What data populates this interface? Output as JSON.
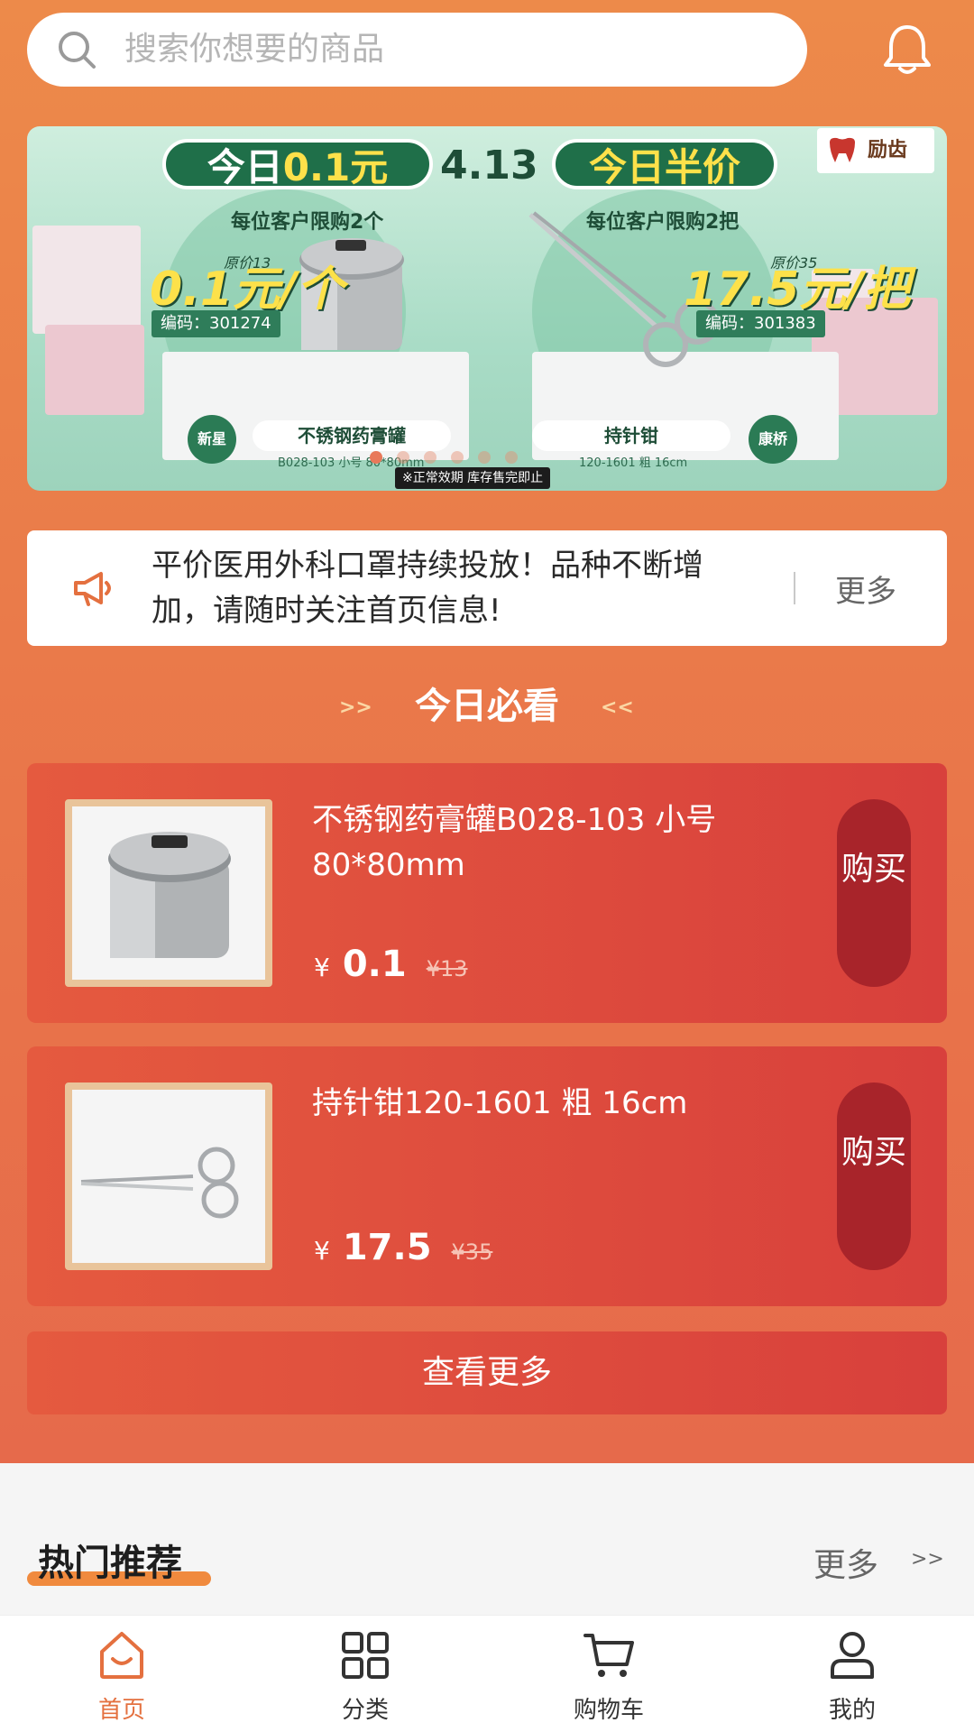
{
  "search": {
    "placeholder": "搜索你想要的商品"
  },
  "banner": {
    "left": {
      "title_prefix": "今日",
      "title_highlight": "0.1元",
      "limit": "每位客户限购2个",
      "price": "0.1元/个",
      "original": "原价13",
      "code": "编码：301274",
      "name": "不锈钢药膏罐",
      "spec": "B028-103 小号 80*80mm",
      "tag": "新星"
    },
    "date": "4.13",
    "right": {
      "title": "今日半价",
      "limit": "每位客户限购2把",
      "price": "17.5元/把",
      "original": "原价35",
      "code": "编码：301383",
      "name": "持针钳",
      "spec": "120-1601 粗 16cm",
      "tag": "康桥"
    },
    "notice": "※正常效期 库存售完即止",
    "logo": "励齿",
    "dots": 6,
    "active_dot": 0
  },
  "announcement": {
    "text": "平价医用外科口罩持续投放！品种不断增加，请随时关注首页信息!",
    "more": "更多"
  },
  "today_section": {
    "title": "今日必看",
    "left_mark": ">>",
    "right_mark": "<<"
  },
  "products": [
    {
      "name": "不锈钢药膏罐B028-103 小号 80*80mm",
      "currency": "¥",
      "price": "0.1",
      "original_price": "¥13",
      "buy_label": "购买"
    },
    {
      "name": "持针钳120-1601 粗 16cm",
      "currency": "¥",
      "price": "17.5",
      "original_price": "¥35",
      "buy_label": "购买"
    }
  ],
  "view_more": "查看更多",
  "hot": {
    "title": "热门推荐",
    "more": "更多",
    "arrow": ">>"
  },
  "tabbar": [
    {
      "label": "首页",
      "icon": "home-icon",
      "active": true
    },
    {
      "label": "分类",
      "icon": "category-icon",
      "active": false
    },
    {
      "label": "购物车",
      "icon": "cart-icon",
      "active": false
    },
    {
      "label": "我的",
      "icon": "user-icon",
      "active": false
    }
  ],
  "colors": {
    "accent": "#e4703f",
    "buy_button": "#a8242a",
    "card": "#d8403c"
  }
}
